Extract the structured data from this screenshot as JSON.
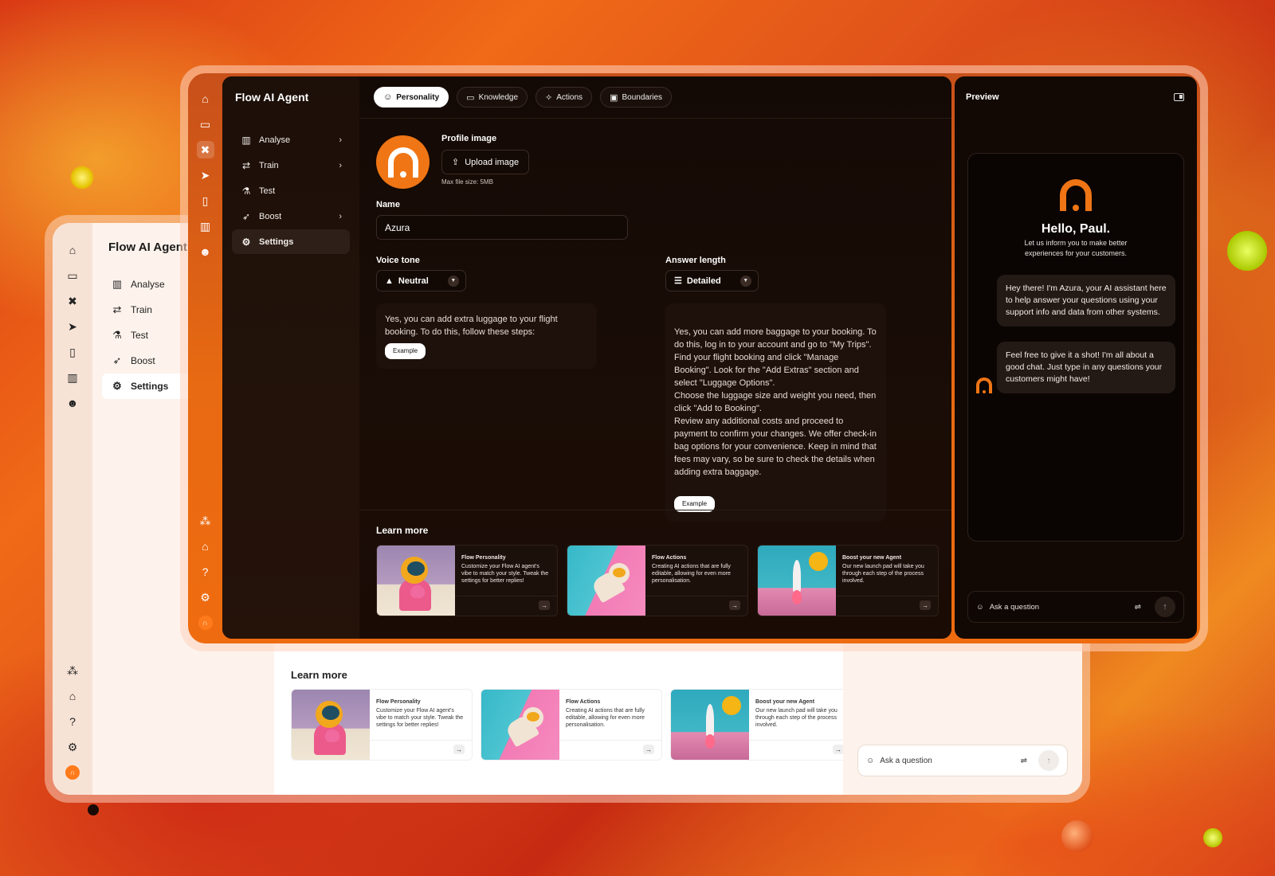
{
  "app": {
    "title": "Flow AI Agent"
  },
  "nav": {
    "items": [
      {
        "label": "Analyse",
        "icon": "bar-chart-icon",
        "glyph": "▥",
        "chevron": true
      },
      {
        "label": "Train",
        "icon": "sliders-icon",
        "glyph": "⇄",
        "chevron": true
      },
      {
        "label": "Test",
        "icon": "flask-icon",
        "glyph": "⚗",
        "chevron": false
      },
      {
        "label": "Boost",
        "icon": "rocket-icon",
        "glyph": "➶",
        "chevron": true
      },
      {
        "label": "Settings",
        "icon": "gear-icon",
        "glyph": "⚙",
        "chevron": false,
        "active": true
      }
    ]
  },
  "tabs": [
    {
      "label": "Personality",
      "icon": "personality-icon",
      "glyph": "☺",
      "active": true
    },
    {
      "label": "Knowledge",
      "icon": "book-icon",
      "glyph": "▭"
    },
    {
      "label": "Actions",
      "icon": "cursor-click-icon",
      "glyph": "✧"
    },
    {
      "label": "Boundaries",
      "icon": "boundaries-icon",
      "glyph": "▣"
    }
  ],
  "profile": {
    "label": "Profile image",
    "upload_label": "Upload image",
    "hint": "Max file size: 5MB"
  },
  "name": {
    "label": "Name",
    "value": "Azura"
  },
  "voice_tone": {
    "label": "Voice tone",
    "value": "Neutral",
    "example_text": "Yes, you can add extra luggage to your flight booking. To do this, follow these steps:",
    "example_label": "Example"
  },
  "answer_length": {
    "label": "Answer length",
    "value": "Detailed",
    "example_text": "Yes, you can add more baggage to your booking. To do this, log in to your account and go to \"My Trips\". Find your flight booking and click \"Manage Booking\". Look for the \"Add Extras\" section and select \"Luggage Options\".\nChoose the luggage size and weight you need, then click \"Add to Booking\".\nReview any additional costs and proceed to payment to confirm your changes. We offer check-in bag options for your convenience. Keep in mind that fees may vary, so be sure to check the details when adding extra baggage.",
    "example_label": "Example"
  },
  "learn_more": {
    "title": "Learn more",
    "cards": [
      {
        "title": "Flow Personality",
        "desc": "Customize your Flow AI agent's vibe to match your style. Tweak the settings for better replies!"
      },
      {
        "title": "Flow Actions",
        "desc": "Creating AI actions that are fully editable, allowing for even more personalisation."
      },
      {
        "title": "Boost your new Agent",
        "desc": "Our new launch pad will take you through each step of the process involved."
      }
    ]
  },
  "preview": {
    "title": "Preview",
    "greeting": "Hello, Paul.",
    "subtitle": "Let us inform you to make better experiences for your customers.",
    "messages": [
      "Hey there! I'm Azura, your AI assistant here to help answer your questions using your support info and data from other systems.",
      "Feel free to give it a shot! I'm all about a good chat. Just type in any questions your customers might have!"
    ],
    "ask_placeholder": "Ask a question"
  },
  "colors": {
    "accent": "#f07514",
    "dark_bg": "#120905",
    "light_bg": "#fbe9dd"
  }
}
